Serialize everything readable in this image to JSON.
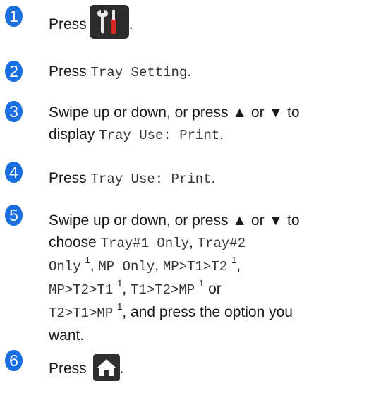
{
  "steps": [
    {
      "num": "1",
      "press": "Press",
      "period": "."
    },
    {
      "num": "2",
      "press": "Press",
      "value": "Tray Setting",
      "period": "."
    },
    {
      "num": "3",
      "line1": "Swipe up or down, or press ▲ or ▼ to",
      "display": "display",
      "value": "Tray Use: Print",
      "period": "."
    },
    {
      "num": "4",
      "press": "Press",
      "value": "Tray Use: Print",
      "period": "."
    },
    {
      "num": "5",
      "line1": "Swipe up or down, or press ▲ or ▼ to",
      "choose": "choose",
      "opt1": "Tray#1 Only",
      "comma": ",",
      "opt2a": "Tray#2",
      "opt2b": "Only",
      "sup": "1",
      "opt3": "MP Only",
      "opt4": "MP>T1>T2",
      "opt5": "MP>T2>T1",
      "opt6": "T1>T2>MP",
      "or": "or",
      "opt7": "T2>T1>MP",
      "tail1": ", and press the option you",
      "tail2": "want."
    },
    {
      "num": "6",
      "press": "Press",
      "period": "."
    }
  ],
  "icons": {
    "settings": "tools-icon",
    "home": "home-icon"
  },
  "colors": {
    "step_badge": "#1a6fe0",
    "icon_bg": "#2c2c2c"
  }
}
